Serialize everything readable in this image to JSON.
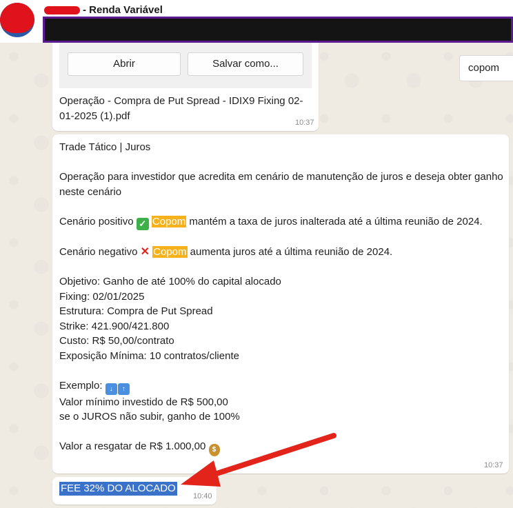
{
  "header": {
    "title_suffix": "- Renda Variável"
  },
  "search": {
    "value": "copom"
  },
  "document": {
    "open_label": "Abrir",
    "save_label": "Salvar como...",
    "filename": "Operação - Compra de Put Spread  - IDIX9 Fixing 02-01-2025 (1).pdf",
    "time": "10:37"
  },
  "message": {
    "line1": "Trade Tático | Juros",
    "line2": "Operação para investidor que acredita em cenário de manutenção de juros e deseja obter ganho neste cenário",
    "positive_prefix": "Cenário positivo ",
    "positive_highlight": "Copom",
    "positive_suffix": " mantém a taxa de juros inalterada até a última reunião de 2024.",
    "negative_prefix": "Cenário negativo ",
    "negative_highlight": "Copom",
    "negative_suffix": " aumenta juros até a última reunião de 2024.",
    "objetivo": "Objetivo: Ganho de até 100% do capital alocado",
    "fixing": "Fixing: 02/01/2025",
    "estrutura": "Estrutura: Compra de Put Spread",
    "strike": "Strike: 421.900/421.800",
    "custo": "Custo: R$ 50,00/contrato",
    "exposicao": "Exposição Mínima: 10 contratos/cliente",
    "exemplo": "Exemplo: ",
    "valor_minimo": "Valor mínimo investido de R$ 500,00",
    "se_juros": "se o JUROS não subir, ganho de 100%",
    "valor_resgatar": "Valor a resgatar de R$ 1.000,00 ",
    "time": "10:37"
  },
  "fee": {
    "text": "FEE 32% DO ALOCADO",
    "time": "10:40"
  },
  "colors": {
    "highlight": "#f7b21b",
    "selection": "#3a72c9",
    "arrow": "#e3241b"
  }
}
